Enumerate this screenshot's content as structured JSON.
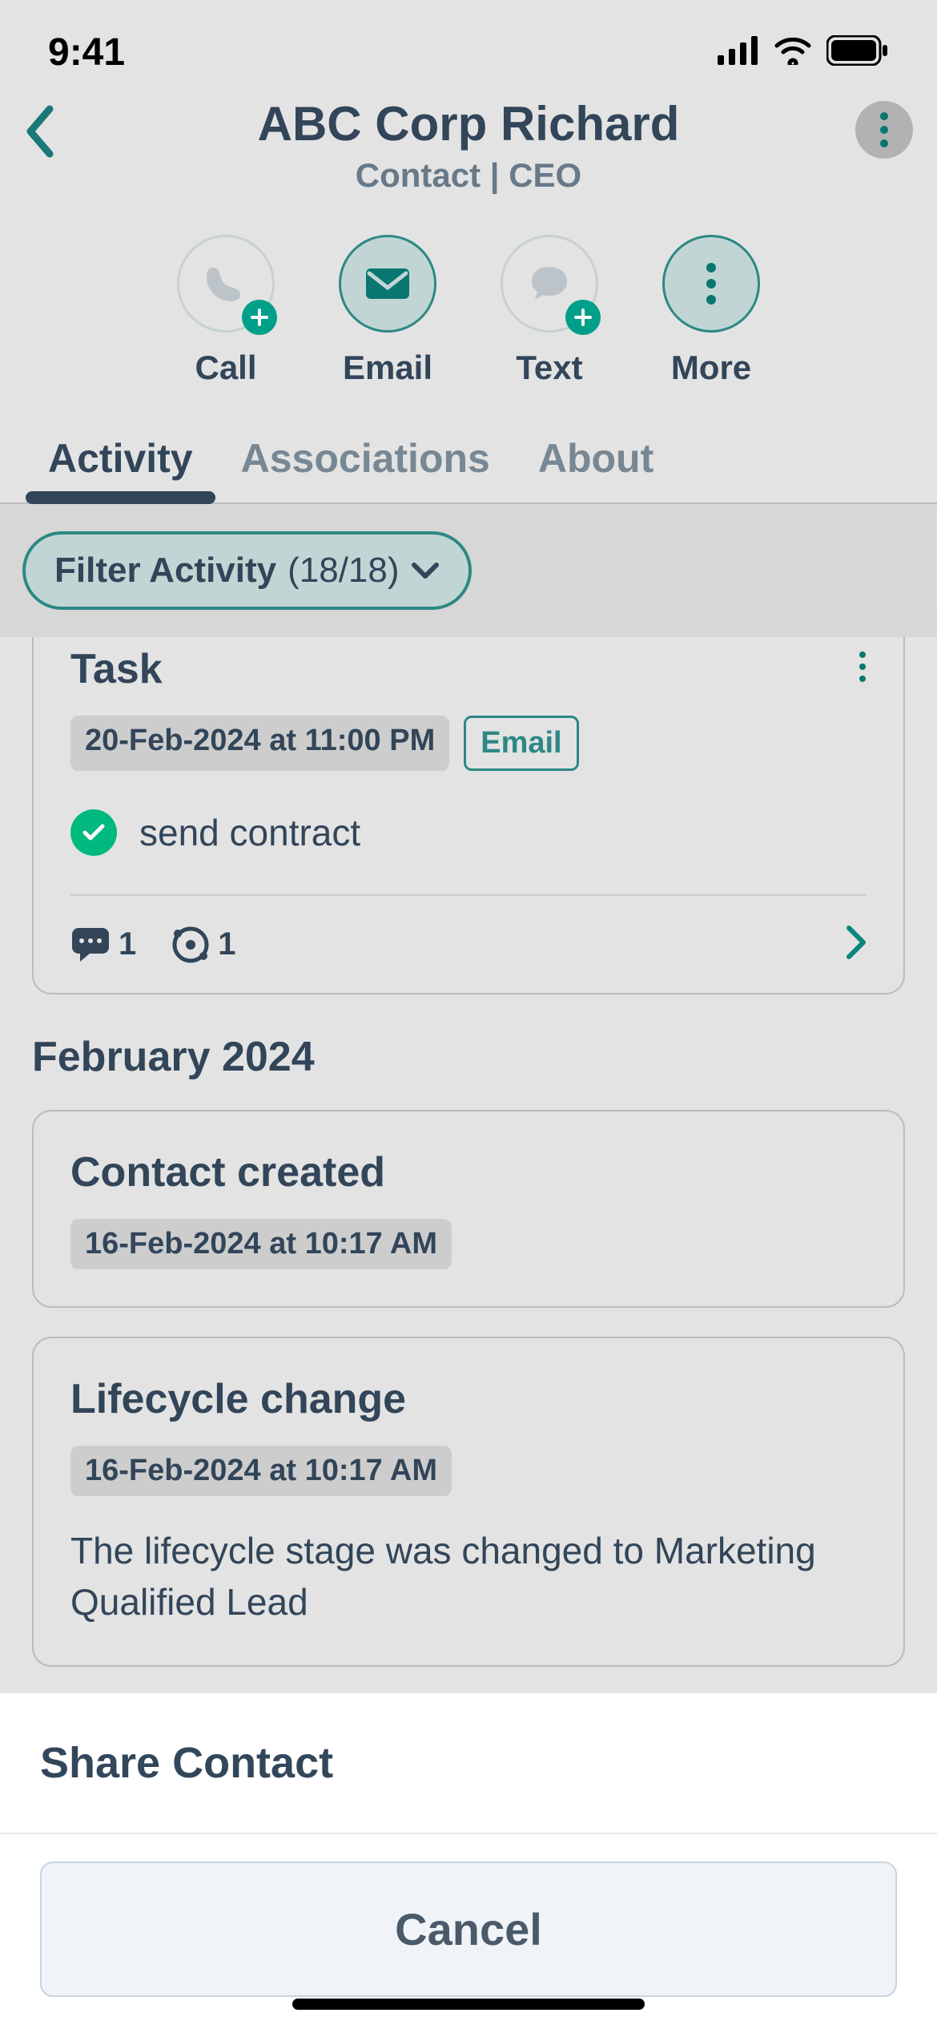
{
  "status": {
    "time": "9:41"
  },
  "header": {
    "title": "ABC Corp Richard",
    "subtitle": "Contact | CEO"
  },
  "actions": {
    "call": "Call",
    "email": "Email",
    "text": "Text",
    "more": "More"
  },
  "tabs": {
    "activity": "Activity",
    "associations": "Associations",
    "about": "About"
  },
  "filter": {
    "label": "Filter Activity ",
    "count": "(18/18)"
  },
  "task_card": {
    "title": "Task",
    "date": "20-Feb-2024 at 11:00 PM",
    "tag": "Email",
    "text": "send contract",
    "comments": "1",
    "associations": "1"
  },
  "month": "February 2024",
  "created_card": {
    "title": "Contact created",
    "date": "16-Feb-2024 at 10:17 AM"
  },
  "lifecycle_card": {
    "title": "Lifecycle change",
    "date": "16-Feb-2024 at 10:17 AM",
    "body": "The lifecycle stage was changed to Marketing Qualified Lead"
  },
  "sheet": {
    "share": "Share Contact",
    "cancel": "Cancel"
  }
}
